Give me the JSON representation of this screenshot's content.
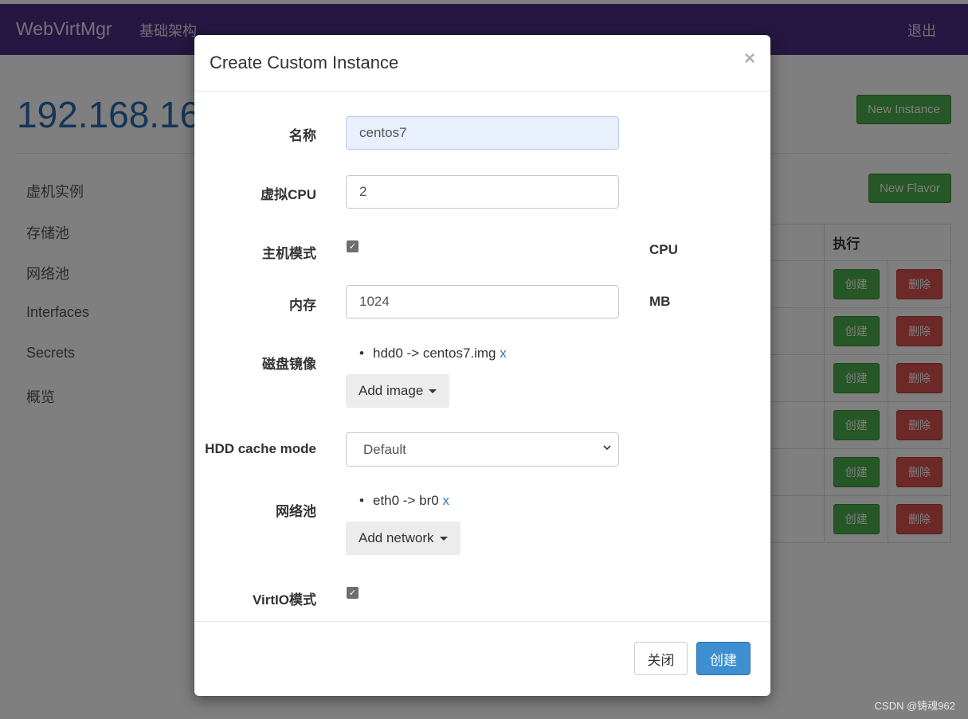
{
  "navbar": {
    "brand": "WebVirtMgr",
    "nav_link": "基础架构",
    "logout": "退出"
  },
  "page": {
    "host_title": "192.168.16",
    "sidebar": [
      "虚机实例",
      "存储池",
      "网络池",
      "Interfaces",
      "Secrets",
      "概览"
    ],
    "new_instance_label": "New Instance",
    "new_flavor_label": "New Flavor",
    "table_header_action": "执行",
    "row_create_label": "创建",
    "row_delete_label": "删除"
  },
  "modal": {
    "title": "Create Custom Instance",
    "close_symbol": "×",
    "fields": {
      "name_label": "名称",
      "name_value": "centos7",
      "vcpu_label": "虚拟CPU",
      "vcpu_value": "2",
      "host_model_label": "主机模式",
      "host_model_checked": true,
      "host_model_unit": "CPU",
      "memory_label": "内存",
      "memory_value": "1024",
      "memory_unit": "MB",
      "disk_label": "磁盘镜像",
      "disk_items": [
        "hdd0 -> centos7.img"
      ],
      "remove_symbol": "x",
      "add_image_label": "Add image",
      "cache_label": "HDD cache mode",
      "cache_value": "Default",
      "network_label": "网络池",
      "network_items": [
        "eth0 -> br0"
      ],
      "add_network_label": "Add network",
      "virtio_label": "VirtIO模式",
      "virtio_checked": true
    },
    "footer": {
      "close_label": "关闭",
      "create_label": "创建"
    }
  },
  "watermark": "CSDN @铸魂962",
  "colors": {
    "navbar": "#4b2e83",
    "primary": "#3e8fd1",
    "success": "#4cae4c",
    "danger": "#d9534f",
    "link": "#337ab7"
  }
}
